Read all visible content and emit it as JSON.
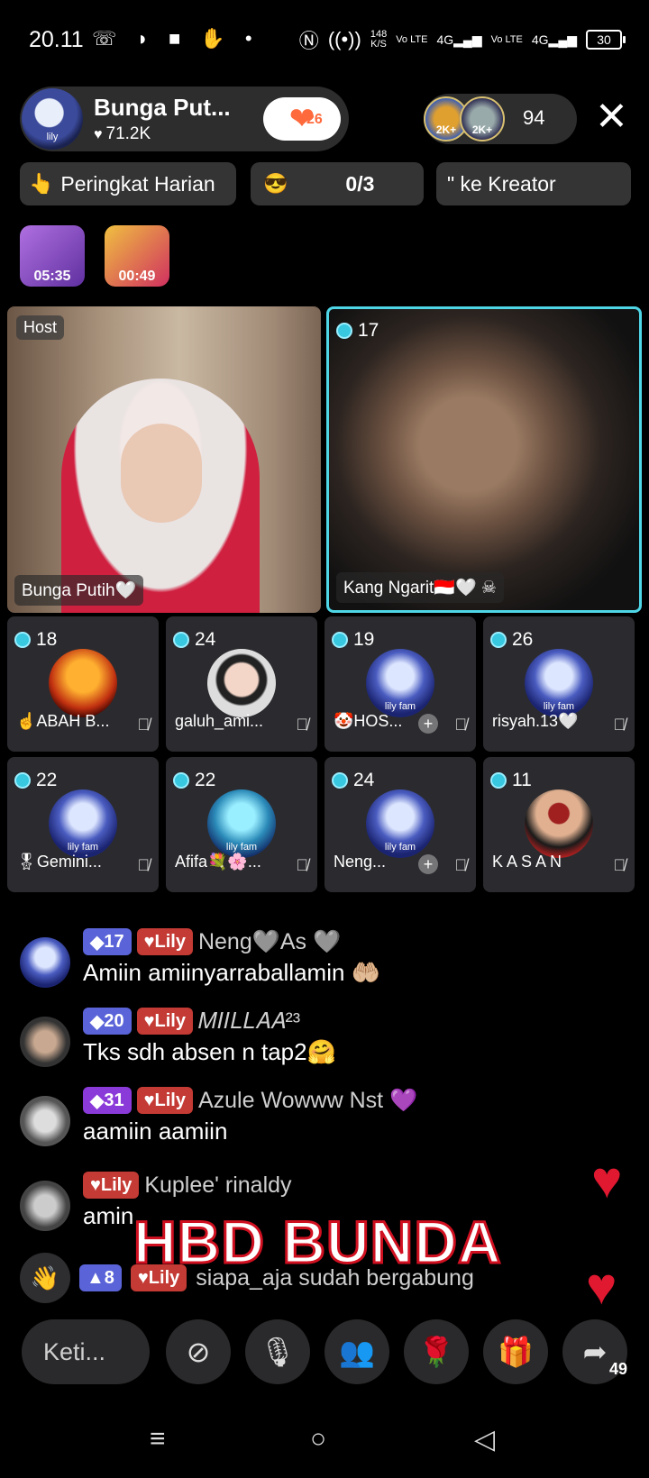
{
  "status_bar": {
    "time": "20.11",
    "left_icons": "☏ ◗ ■ ✋ •",
    "speed_top": "148",
    "speed_bottom": "K/S",
    "net1": "Vo LTE",
    "net2": "4G",
    "net3": "Vo LTE",
    "net4": "4G",
    "battery": "30"
  },
  "host": {
    "name": "Bunga Put...",
    "likes": "71.2K",
    "avatar_label": "lily",
    "follow_count": "26"
  },
  "viewers": {
    "badge1": "2K+",
    "badge2": "2K+",
    "count": "94"
  },
  "chips": {
    "daily_rank": "Peringkat Harian",
    "score": "0/3",
    "creator": "\" ke Kreator"
  },
  "gifts": [
    {
      "timer": "05:35"
    },
    {
      "timer": "00:49"
    }
  ],
  "stage": {
    "host_badge": "Host",
    "host_label": "Bunga Putih🤍",
    "guest_level": "17",
    "guest_label": "Kang Ngarit🇮🇩🤍 ☠"
  },
  "guests": [
    {
      "level": "18",
      "name": "☝ABAH B...",
      "avatar_text": ""
    },
    {
      "level": "24",
      "name": "galuh_ami...",
      "avatar_text": ""
    },
    {
      "level": "19",
      "name": "🤡HOS...",
      "avatar_text": "lily fam"
    },
    {
      "level": "26",
      "name": "risyah.13🤍",
      "avatar_text": "lily fam"
    },
    {
      "level": "22",
      "name": "🎖Gemini...",
      "avatar_text": "lily fam"
    },
    {
      "level": "22",
      "name": "Afifa💐🌸...",
      "avatar_text": "lily fam"
    },
    {
      "level": "24",
      "name": "Neng...",
      "avatar_text": "lily fam"
    },
    {
      "level": "11",
      "name": "K A S A N",
      "avatar_text": ""
    }
  ],
  "chat": [
    {
      "level": "17",
      "fan": "Lily",
      "user": "Neng🩶As 🩶",
      "text": "Amiin amiinyarraballamin 🤲🏼"
    },
    {
      "level": "20",
      "fan": "Lily",
      "user": "𝑀𝐼𝐼𝐿𝐿𝐴𝐴²³",
      "text": "Tks sdh absen n tap2🤗"
    },
    {
      "level": "31",
      "fan": "Lily",
      "user": "Azule Wowww Nst 💜",
      "text": "aamiin aamiin"
    },
    {
      "level": "",
      "fan": "Lily",
      "user": "Kuplee' rinaldy",
      "text": "amin"
    }
  ],
  "join": {
    "level": "8",
    "fan": "Lily",
    "text": "siapa_aja sudah bergabung"
  },
  "overlay_text": "HBD BUNDA",
  "bottom": {
    "input_placeholder": "Keti...",
    "share_count": "49"
  }
}
